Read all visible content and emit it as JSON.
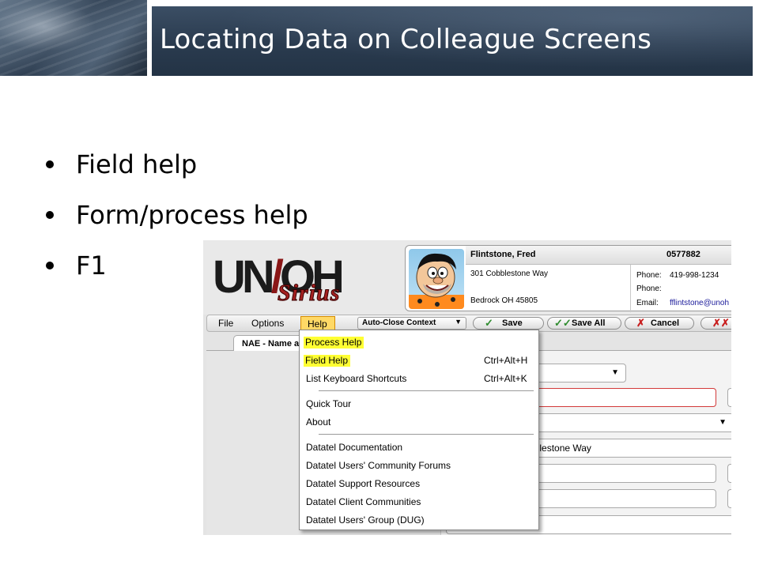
{
  "slide": {
    "title": "Locating Data on Colleague Screens",
    "bullets": [
      "Field help",
      "Form/process help",
      "F1"
    ]
  },
  "app": {
    "logo": {
      "main": "UNOH",
      "sub": "Sirius"
    },
    "person": {
      "name": "Flintstone, Fred",
      "id": "0577882",
      "address1": "301 Cobblestone Way",
      "address2": "Bedrock OH 45805",
      "phone1_label": "Phone:",
      "phone1_value": "419-998-1234",
      "phone2_label": "Phone:",
      "email_label": "Email:",
      "email_value": "fflintstone@unoh"
    },
    "menubar": {
      "file": "File",
      "options": "Options",
      "help": "Help",
      "context_select": "Auto-Close Context",
      "save": "Save",
      "save_all": "Save All",
      "cancel": "Cancel"
    },
    "tab": {
      "label": "NAE - Name and"
    },
    "form": {
      "address_value": "oblestone Way"
    },
    "help_menu": {
      "items": [
        {
          "label": "Process Help",
          "shortcut": "",
          "highlighted": true
        },
        {
          "label": "Field Help",
          "shortcut": "Ctrl+Alt+H",
          "highlighted": true
        },
        {
          "label": "List Keyboard Shortcuts",
          "shortcut": "Ctrl+Alt+K",
          "highlighted": false
        },
        {
          "label": "Quick Tour",
          "shortcut": "",
          "highlighted": false
        },
        {
          "label": "About",
          "shortcut": "",
          "highlighted": false
        },
        {
          "label": "Datatel Documentation",
          "shortcut": "",
          "highlighted": false
        },
        {
          "label": "Datatel Users' Community Forums",
          "shortcut": "",
          "highlighted": false
        },
        {
          "label": "Datatel Support Resources",
          "shortcut": "",
          "highlighted": false
        },
        {
          "label": "Datatel Client Communities",
          "shortcut": "",
          "highlighted": false
        },
        {
          "label": "Datatel Users' Group (DUG)",
          "shortcut": "",
          "highlighted": false
        }
      ]
    }
  },
  "colors": {
    "title_bar": "#2a3b4f",
    "highlight": "#ffff33",
    "help_menu_active": "#ffd966",
    "save_check": "#2e8b2e",
    "cancel_x": "#c81e1e"
  },
  "icons": {
    "save": "check-icon",
    "save_all": "double-check-icon",
    "cancel": "x-icon",
    "cancel_all": "double-x-icon",
    "dropdown": "chevron-down-icon"
  }
}
